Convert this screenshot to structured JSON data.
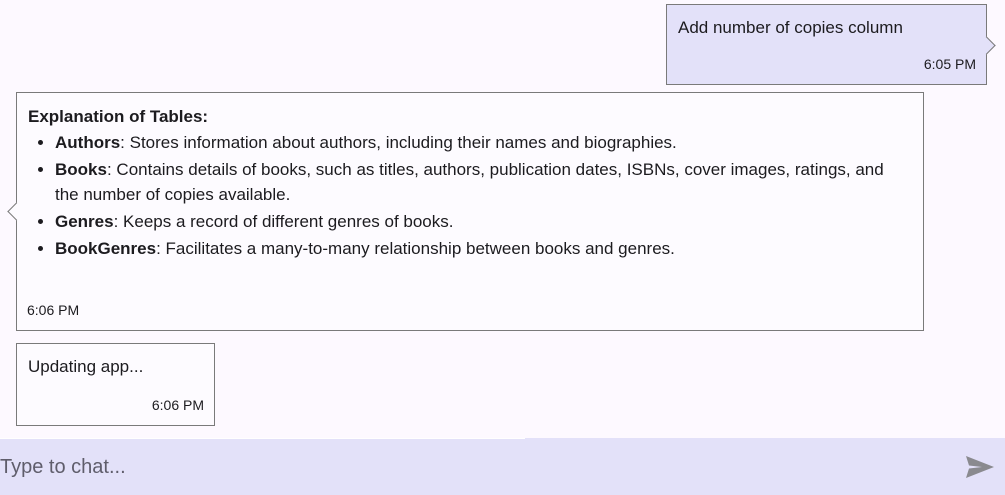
{
  "messages": [
    {
      "role": "user",
      "text": "Add number of copies column",
      "time": "6:05 PM"
    },
    {
      "role": "assistant",
      "heading": "Explanation of Tables:",
      "items": [
        {
          "term": "Authors",
          "desc": ": Stores information about authors, including their names and biographies."
        },
        {
          "term": "Books",
          "desc": ": Contains details of books, such as titles, authors, publication dates, ISBNs, cover images, ratings, and the number of copies available."
        },
        {
          "term": "Genres",
          "desc": ": Keeps a record of different genres of books."
        },
        {
          "term": "BookGenres",
          "desc": ": Facilitates a many-to-many relationship between books and genres."
        }
      ],
      "time": "6:06 PM"
    },
    {
      "role": "assistant",
      "text": "Updating app...",
      "time": "6:06 PM"
    }
  ],
  "composer": {
    "placeholder": "Type to chat...",
    "value": "",
    "send_icon": "send-icon"
  },
  "colors": {
    "background": "#fdf9ff",
    "user_bubble": "#e3e1f9",
    "composer_bg": "#e3e1f9",
    "send_icon": "#8a8a8f"
  }
}
